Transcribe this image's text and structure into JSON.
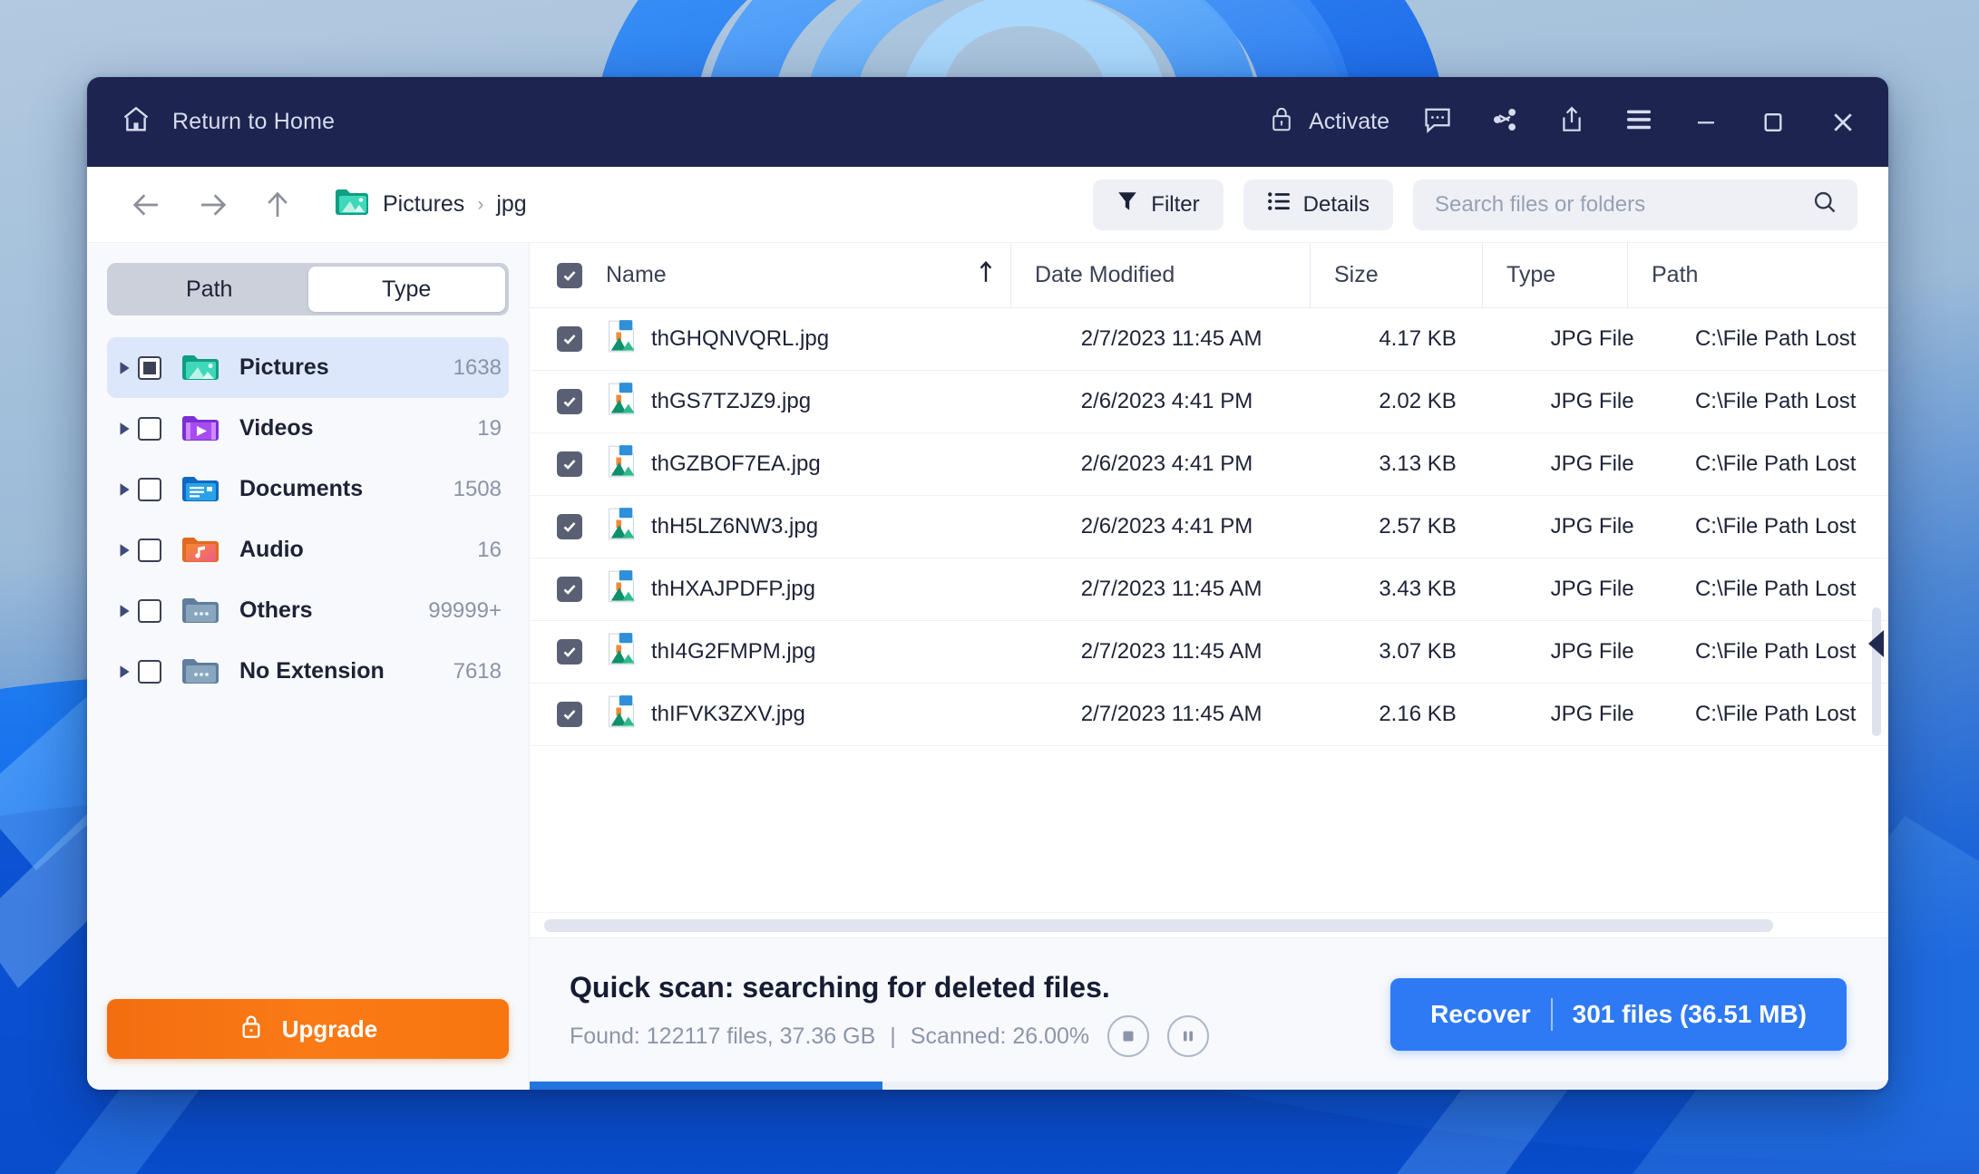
{
  "titlebar": {
    "home_label": "Return to Home",
    "activate_label": "Activate",
    "icons": [
      "lock-icon",
      "feedback-icon",
      "share-icon",
      "export-icon",
      "hamburger-menu-icon"
    ],
    "window_controls": [
      "minimize",
      "maximize",
      "close"
    ]
  },
  "toolbar": {
    "back": "back-arrow",
    "forward": "forward-arrow",
    "up": "up-arrow",
    "breadcrumb": [
      "Pictures",
      "jpg"
    ],
    "breadcrumb_separator": "›",
    "filter_label": "Filter",
    "details_label": "Details",
    "search_placeholder": "Search files or folders",
    "search_value": ""
  },
  "sidebar": {
    "segments": [
      {
        "label": "Path",
        "active": false
      },
      {
        "label": "Type",
        "active": true
      }
    ],
    "tree": [
      {
        "label": "Pictures",
        "count": "1638",
        "checkbox": "indeterminate",
        "selected": true,
        "icon": "pictures-folder-icon"
      },
      {
        "label": "Videos",
        "count": "19",
        "checkbox": "unchecked",
        "selected": false,
        "icon": "videos-folder-icon"
      },
      {
        "label": "Documents",
        "count": "1508",
        "checkbox": "unchecked",
        "selected": false,
        "icon": "documents-folder-icon"
      },
      {
        "label": "Audio",
        "count": "16",
        "checkbox": "unchecked",
        "selected": false,
        "icon": "audio-folder-icon"
      },
      {
        "label": "Others",
        "count": "99999+",
        "checkbox": "unchecked",
        "selected": false,
        "icon": "others-folder-icon"
      },
      {
        "label": "No Extension",
        "count": "7618",
        "checkbox": "unchecked",
        "selected": false,
        "icon": "no-extension-folder-icon"
      }
    ],
    "upgrade_label": "Upgrade"
  },
  "filetable": {
    "headers": {
      "name": "Name",
      "date": "Date Modified",
      "size": "Size",
      "type": "Type",
      "path": "Path"
    },
    "sort": {
      "column": "Name",
      "direction": "ascending",
      "glyph": "↑"
    },
    "select_all": "checked",
    "rows": [
      {
        "name": "thGHQNVQRL.jpg",
        "date": "2/7/2023 11:45 AM",
        "size": "4.17 KB",
        "type": "JPG File",
        "path": "C:\\File Path Lost",
        "checked": true
      },
      {
        "name": "thGS7TZJZ9.jpg",
        "date": "2/6/2023 4:41 PM",
        "size": "2.02 KB",
        "type": "JPG File",
        "path": "C:\\File Path Lost",
        "checked": true
      },
      {
        "name": "thGZBOF7EA.jpg",
        "date": "2/6/2023 4:41 PM",
        "size": "3.13 KB",
        "type": "JPG File",
        "path": "C:\\File Path Lost",
        "checked": true
      },
      {
        "name": "thH5LZ6NW3.jpg",
        "date": "2/6/2023 4:41 PM",
        "size": "2.57 KB",
        "type": "JPG File",
        "path": "C:\\File Path Lost",
        "checked": true
      },
      {
        "name": "thHXAJPDFP.jpg",
        "date": "2/7/2023 11:45 AM",
        "size": "3.43 KB",
        "type": "JPG File",
        "path": "C:\\File Path Lost",
        "checked": true
      },
      {
        "name": "thI4G2FMPM.jpg",
        "date": "2/7/2023 11:45 AM",
        "size": "3.07 KB",
        "type": "JPG File",
        "path": "C:\\File Path Lost",
        "checked": true
      },
      {
        "name": "thIFVK3ZXV.jpg",
        "date": "2/7/2023 11:45 AM",
        "size": "2.16 KB",
        "type": "JPG File",
        "path": "C:\\File Path Lost",
        "checked": true
      }
    ]
  },
  "statusbar": {
    "title": "Quick scan: searching for deleted files.",
    "found": "Found: 122117 files, 37.36 GB",
    "separator": "|",
    "scanned": "Scanned: 26.00%",
    "progress_percent": 26,
    "stop_icon": "stop-icon",
    "pause_icon": "pause-icon",
    "recover_label": "Recover",
    "recover_detail": "301 files (36.51 MB)"
  },
  "colors": {
    "titlebar_bg": "#1d2450",
    "accent_blue": "#2e7af5",
    "upgrade_orange": "#f36d10",
    "selected_row": "#dce7fb",
    "progress_fill": "#2375e0"
  }
}
